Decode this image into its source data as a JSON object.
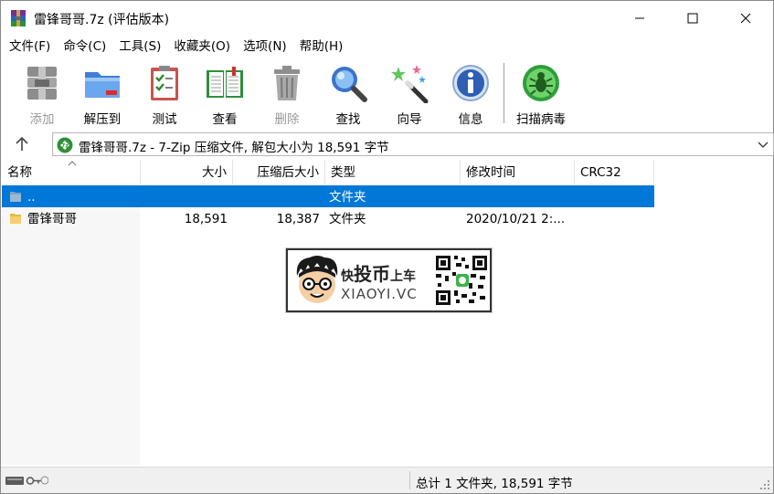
{
  "window": {
    "title": "雷锋哥哥.7z (评估版本)",
    "accent_color": "#0078d7"
  },
  "menu": [
    "文件(F)",
    "命令(C)",
    "工具(S)",
    "收藏夹(O)",
    "选项(N)",
    "帮助(H)"
  ],
  "toolbar": {
    "buttons": [
      {
        "label": "添加",
        "icon": "add-archive-icon",
        "enabled": false
      },
      {
        "label": "解压到",
        "icon": "extract-folder-icon",
        "enabled": true
      },
      {
        "label": "测试",
        "icon": "test-clipboard-icon",
        "enabled": true
      },
      {
        "label": "查看",
        "icon": "view-book-icon",
        "enabled": true
      },
      {
        "label": "删除",
        "icon": "trash-icon",
        "enabled": false
      },
      {
        "label": "查找",
        "icon": "magnifier-icon",
        "enabled": true
      },
      {
        "label": "向导",
        "icon": "wizard-wand-icon",
        "enabled": true
      },
      {
        "label": "信息",
        "icon": "info-icon",
        "enabled": true
      },
      {
        "label": "扫描病毒",
        "icon": "virus-scan-icon",
        "enabled": true
      }
    ]
  },
  "address": {
    "text": "雷锋哥哥.7z - 7-Zip 压缩文件, 解包大小为 18,591 字节"
  },
  "columns": {
    "name": "名称",
    "size": "大小",
    "packed": "压缩后大小",
    "type": "类型",
    "modified": "修改时间",
    "crc": "CRC32"
  },
  "rows": [
    {
      "name": "..",
      "size": "",
      "packed": "",
      "type": "文件夹",
      "modified": "",
      "crc": "",
      "selected": true
    },
    {
      "name": "雷锋哥哥",
      "size": "18,591",
      "packed": "18,387",
      "type": "文件夹",
      "modified": "2020/10/21 2:...",
      "crc": "",
      "selected": false
    }
  ],
  "watermark": {
    "line1_a": "快",
    "line1_b": "投币",
    "line1_c": "上车",
    "line2": "XIAOYI.VC"
  },
  "status": {
    "text": "总计 1 文件夹, 18,591 字节"
  }
}
